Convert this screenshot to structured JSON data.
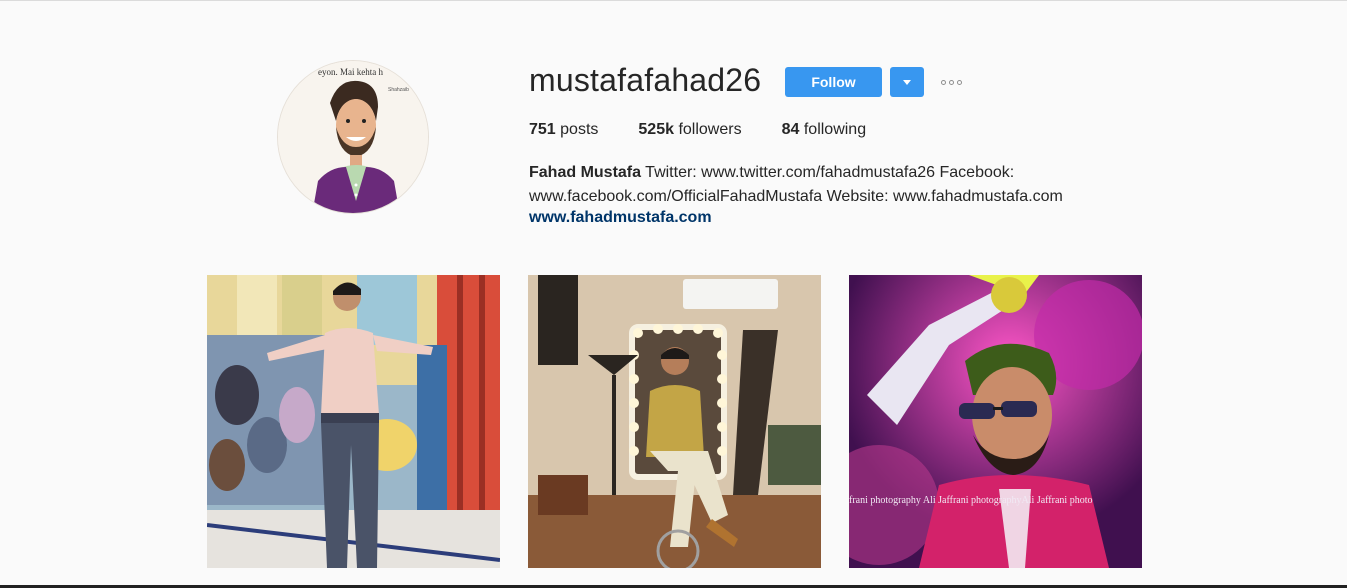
{
  "profile": {
    "username": "mustafafahad26",
    "follow_label": "Follow",
    "stats": {
      "posts_count": "751",
      "posts_label": "posts",
      "followers_count": "525k",
      "followers_label": "followers",
      "following_count": "84",
      "following_label": "following"
    },
    "bio": {
      "full_name": "Fahad Mustafa",
      "text": "Twitter: www.twitter.com/fahadmustafa26 Facebook: www.facebook.com/OfficialFahadMustafa Website: www.fahadmustafa.com",
      "link": "www.fahadmustafa.com"
    },
    "avatar_caption_top": "eyon. Mai kehta h",
    "avatar_caption_small": "Shahzaib"
  },
  "posts": [
    {
      "watermark": ""
    },
    {
      "watermark": ""
    },
    {
      "watermark": "frani photography Ali Jaffrani photographyAli Jaffrani photo"
    }
  ],
  "colors": {
    "accent": "#3897f0",
    "link": "#003569",
    "background": "#fafafa",
    "text": "#262626"
  },
  "icons": [
    "dropdown-caret-icon",
    "more-options-icon"
  ]
}
